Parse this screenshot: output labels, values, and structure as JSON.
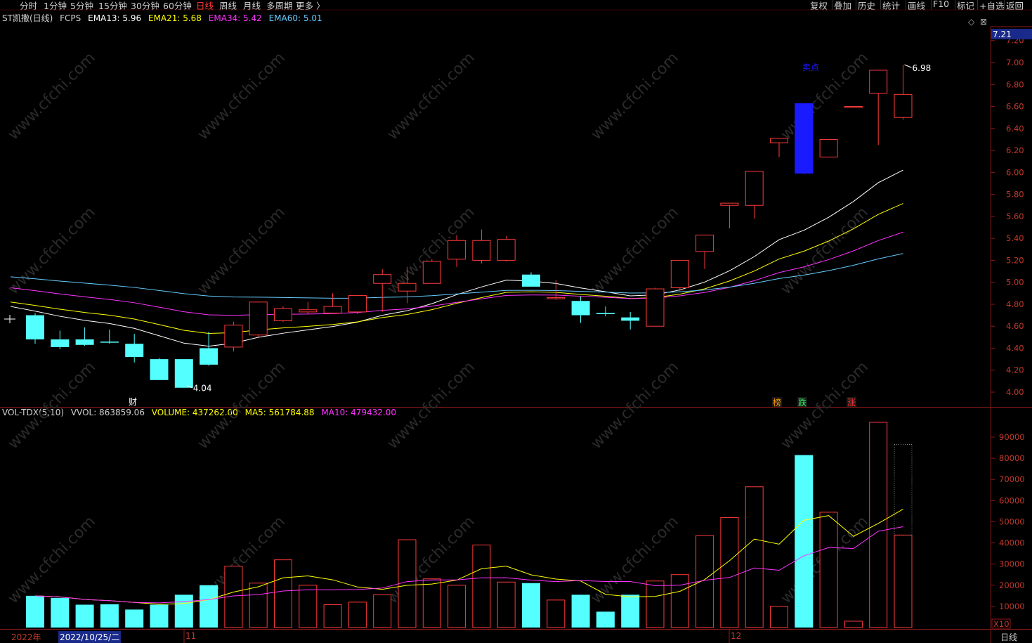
{
  "toolbar": {
    "periods": [
      "分时",
      "1分钟",
      "5分钟",
      "15分钟",
      "30分钟",
      "60分钟",
      "日线",
      "周线",
      "月线",
      "多周期",
      "更多 〉"
    ],
    "active_period": "日线",
    "right_buttons": [
      "复权",
      "叠加",
      "历史",
      "统计",
      "画线",
      "F10",
      "标记",
      "+自选",
      "返回"
    ]
  },
  "legend": {
    "stock": "ST凯撒(日线)",
    "indicator": "FCPS",
    "ema13": "EMA13: 5.96",
    "ema21": "EMA21: 5.68",
    "ema34": "EMA34: 5.42",
    "ema60": "EMA60: 5.01"
  },
  "vol_legend": {
    "name": "VOL-TDX(5,10)",
    "vvol": "VVOL: 863859.06",
    "volume": "VOLUME: 437262.00",
    "ma5": "MA5: 561784.88",
    "ma10": "MA10: 479432.00"
  },
  "price_axis": {
    "current_price": "7.21",
    "ticks": [
      "7.20",
      "7.00",
      "6.80",
      "6.60",
      "6.40",
      "6.20",
      "6.00",
      "5.80",
      "5.60",
      "5.40",
      "5.20",
      "5.00",
      "4.80",
      "4.60",
      "4.40",
      "4.20",
      "4.00"
    ]
  },
  "vol_axis": {
    "ticks": [
      "90000",
      "80000",
      "70000",
      "60000",
      "50000",
      "40000",
      "30000",
      "20000",
      "10000"
    ],
    "multiplier": "X10"
  },
  "annotations": {
    "high": "6.98",
    "low": "4.04",
    "sell_point": "卖点",
    "fin_marker": "财",
    "markers": [
      {
        "text": "榜",
        "color": "#ff9900"
      },
      {
        "text": "跌",
        "color": "#33ff66"
      },
      {
        "text": "涨",
        "color": "#ff3333"
      }
    ]
  },
  "bottom_axis": {
    "year": "2022年",
    "cursor_date": "2022/10/25/二",
    "month_11": "11",
    "month_12": "12",
    "period": "日线"
  },
  "watermark": "www.cfchi.com",
  "colors": {
    "up": "#ff3b3b",
    "down": "#54ffff",
    "ema13": "#ffffff",
    "ema21": "#ffff00",
    "ema34": "#ff33ff",
    "ema60": "#66ccff",
    "sell": "#1a1aff"
  },
  "chart_data": {
    "type": "candlestick",
    "note": "daily OHLC, 37 sessions",
    "candles": [
      {
        "o": 4.7,
        "h": 4.72,
        "l": 4.44,
        "c": 4.48
      },
      {
        "o": 4.48,
        "h": 4.56,
        "l": 4.39,
        "c": 4.41
      },
      {
        "o": 4.48,
        "h": 4.59,
        "l": 4.42,
        "c": 4.43
      },
      {
        "o": 4.46,
        "h": 4.57,
        "l": 4.44,
        "c": 4.45
      },
      {
        "o": 4.44,
        "h": 4.53,
        "l": 4.27,
        "c": 4.32
      },
      {
        "o": 4.3,
        "h": 4.31,
        "l": 4.11,
        "c": 4.11
      },
      {
        "o": 4.3,
        "h": 4.3,
        "l": 4.04,
        "c": 4.04
      },
      {
        "o": 4.4,
        "h": 4.55,
        "l": 4.24,
        "c": 4.25
      },
      {
        "o": 4.41,
        "h": 4.64,
        "l": 4.37,
        "c": 4.61
      },
      {
        "o": 4.52,
        "h": 4.82,
        "l": 4.5,
        "c": 4.82
      },
      {
        "o": 4.65,
        "h": 4.78,
        "l": 4.64,
        "c": 4.76
      },
      {
        "o": 4.73,
        "h": 4.82,
        "l": 4.71,
        "c": 4.75
      },
      {
        "o": 4.72,
        "h": 4.9,
        "l": 4.72,
        "c": 4.78
      },
      {
        "o": 4.73,
        "h": 4.88,
        "l": 4.71,
        "c": 4.88
      },
      {
        "o": 4.99,
        "h": 5.12,
        "l": 4.73,
        "c": 5.07
      },
      {
        "o": 4.92,
        "h": 5.14,
        "l": 4.81,
        "c": 4.99
      },
      {
        "o": 4.99,
        "h": 5.21,
        "l": 4.99,
        "c": 5.19
      },
      {
        "o": 5.21,
        "h": 5.43,
        "l": 5.14,
        "c": 5.38
      },
      {
        "o": 5.2,
        "h": 5.48,
        "l": 5.17,
        "c": 5.38
      },
      {
        "o": 5.2,
        "h": 5.42,
        "l": 5.19,
        "c": 5.39
      },
      {
        "o": 5.07,
        "h": 5.09,
        "l": 4.96,
        "c": 4.96
      },
      {
        "o": 4.86,
        "h": 5.02,
        "l": 4.84,
        "c": 4.86
      },
      {
        "o": 4.83,
        "h": 4.87,
        "l": 4.63,
        "c": 4.7
      },
      {
        "o": 4.72,
        "h": 4.78,
        "l": 4.69,
        "c": 4.71
      },
      {
        "o": 4.68,
        "h": 4.73,
        "l": 4.57,
        "c": 4.65
      },
      {
        "o": 4.6,
        "h": 4.95,
        "l": 4.6,
        "c": 4.94
      },
      {
        "o": 4.95,
        "h": 5.2,
        "l": 4.92,
        "c": 5.2
      },
      {
        "o": 5.28,
        "h": 5.43,
        "l": 5.12,
        "c": 5.43
      },
      {
        "o": 5.7,
        "h": 5.72,
        "l": 5.49,
        "c": 5.72
      },
      {
        "o": 5.7,
        "h": 6.01,
        "l": 5.58,
        "c": 6.01
      },
      {
        "o": 6.27,
        "h": 6.31,
        "l": 6.14,
        "c": 6.31
      },
      {
        "o": 6.63,
        "h": 6.63,
        "l": 5.98,
        "c": 5.99
      },
      {
        "o": 6.14,
        "h": 6.3,
        "l": 6.14,
        "c": 6.3
      },
      {
        "o": 6.6,
        "h": 6.6,
        "l": 6.6,
        "c": 6.6
      },
      {
        "o": 6.72,
        "h": 6.93,
        "l": 6.25,
        "c": 6.93
      },
      {
        "o": 6.5,
        "h": 6.98,
        "l": 6.48,
        "c": 6.71
      }
    ],
    "volumes": [
      15000,
      14000,
      10800,
      11000,
      8500,
      10800,
      15500,
      20000,
      29000,
      21000,
      32000,
      20000,
      10800,
      12000,
      15500,
      41500,
      23000,
      20000,
      39000,
      21500,
      21000,
      13000,
      15500,
      7500,
      15500,
      22000,
      25000,
      43500,
      52000,
      66500,
      10000,
      81500,
      54500,
      3000,
      97000,
      43700
    ],
    "ylim": [
      4.0,
      7.21
    ],
    "vol_ylim": [
      0,
      100000
    ]
  }
}
